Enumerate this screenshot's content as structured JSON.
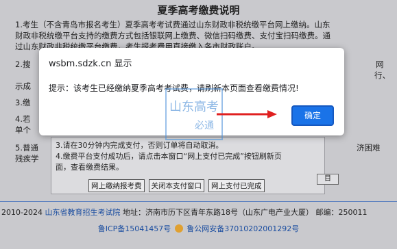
{
  "page": {
    "title": "夏季高考缴费说明",
    "paragraph1": [
      "1.考生（不含青岛市报名考生）夏季高考考试费通过山东财政非税统缴平台网上缴纳。山东",
      "财政非税统缴平台支持的缴费方式包括银联网上缴费、微信扫码缴费、支付宝扫码缴费。通",
      "过山东财政非税统缴平台缴费，考生报考费用直接缴入各市财政账户。"
    ],
    "row2_left": "2.搜",
    "row2_right1": "网",
    "row2_right2": "行、",
    "row2_line3_left": "示成",
    "row3_left": "3.缴",
    "row4_left": "4.若",
    "row4_line2_left": "单个",
    "row5_left": "5.普通",
    "row5_right": "济困难",
    "row5_line2_left": "残疾学"
  },
  "panel": {
    "line1": "3.请在30分钟内完成支付，否则订单将自动取消。",
    "line2": "4.缴费平台支付成功后，请点击本窗口“网上支付已完成”按钮刷新页",
    "line3": "面，查看缴费结果。",
    "buttons": [
      "网上缴纳报考费",
      "关闭本支付窗口",
      "网上支付已完成"
    ],
    "side_button": "目"
  },
  "footer": {
    "copyright": "2010-2024",
    "org": "山东省教育招生考试院",
    "address": "地址：济南市历下区青年东路18号（山东广电产业大厦）",
    "postcode": "邮编：250011",
    "icp": "鲁ICP备15041457号",
    "police": "鲁公网安备37010202001292号"
  },
  "dialog": {
    "title": "wsbm.sdzk.cn 显示",
    "message": "提示：该考生已经缴纳夏季高考考试费，请刷新本页面查看缴费情况!",
    "ok_label": "确定"
  },
  "watermark": {
    "text1": "山东高考",
    "text2": "必通"
  },
  "colors": {
    "accent": "#1a73e8",
    "link": "#1a4da0",
    "arrow": "#e02020"
  }
}
